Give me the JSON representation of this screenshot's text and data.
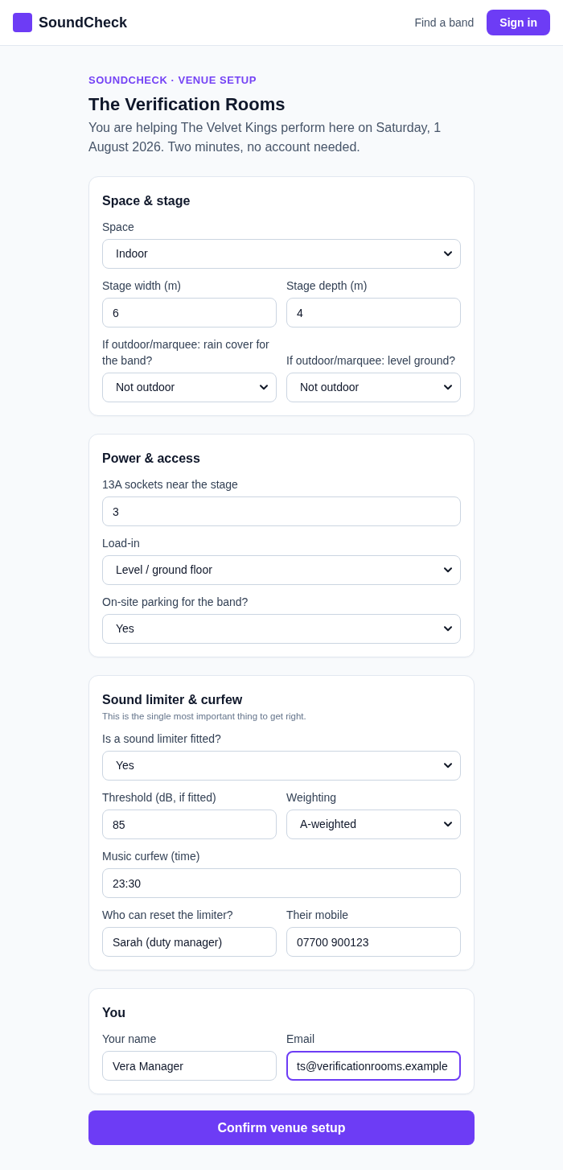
{
  "header": {
    "brand": "SoundCheck",
    "nav_link": "Find a band",
    "sign_in_button": "Sign in"
  },
  "intro": {
    "eyebrow": "SOUNDCHECK · VENUE SETUP",
    "title": "The Verification Rooms",
    "description": "You are helping The Velvet Kings perform here on Saturday, 1 August 2026. Two minutes, no account needed."
  },
  "sections": [
    {
      "title": "Space & stage",
      "rows": [
        {
          "fields": [
            {
              "kind": "select",
              "label": "Space",
              "value": "Indoor",
              "focused": false
            }
          ]
        },
        {
          "fields": [
            {
              "kind": "text",
              "label": "Stage width (m)",
              "value": "6",
              "focused": false
            },
            {
              "kind": "text",
              "label": "Stage depth (m)",
              "value": "4",
              "focused": false
            }
          ]
        },
        {
          "fields": [
            {
              "kind": "select",
              "label": "If outdoor/marquee: rain cover for the band?",
              "value": "Not outdoor",
              "focused": false
            },
            {
              "kind": "select",
              "label": "If outdoor/marquee: level ground?",
              "value": "Not outdoor",
              "focused": false
            }
          ]
        }
      ]
    },
    {
      "title": "Power & access",
      "rows": [
        {
          "fields": [
            {
              "kind": "text",
              "label": "13A sockets near the stage",
              "value": "3",
              "focused": false
            }
          ]
        },
        {
          "fields": [
            {
              "kind": "select",
              "label": "Load-in",
              "value": "Level / ground floor",
              "focused": false
            }
          ]
        },
        {
          "fields": [
            {
              "kind": "select",
              "label": "On-site parking for the band?",
              "value": "Yes",
              "focused": false
            }
          ]
        }
      ]
    },
    {
      "title": "Sound limiter & curfew",
      "note": "This is the single most important thing to get right.",
      "rows": [
        {
          "fields": [
            {
              "kind": "select",
              "label": "Is a sound limiter fitted?",
              "value": "Yes",
              "focused": false
            }
          ]
        },
        {
          "fields": [
            {
              "kind": "text",
              "label": "Threshold (dB, if fitted)",
              "value": "85",
              "focused": false
            },
            {
              "kind": "select",
              "label": "Weighting",
              "value": "A-weighted",
              "focused": false
            }
          ]
        },
        {
          "fields": [
            {
              "kind": "text",
              "label": "Music curfew (time)",
              "value": "23:30",
              "focused": false
            }
          ]
        },
        {
          "fields": [
            {
              "kind": "text",
              "label": "Who can reset the limiter?",
              "value": "Sarah (duty manager)",
              "focused": false
            },
            {
              "kind": "text",
              "label": "Their mobile",
              "value": "07700 900123",
              "focused": false
            }
          ]
        }
      ]
    },
    {
      "title": "You",
      "rows": [
        {
          "fields": [
            {
              "kind": "text",
              "label": "Your name",
              "value": "Vera Manager",
              "focused": false
            },
            {
              "kind": "text",
              "label": "Email",
              "value": "ts@verificationrooms.example",
              "focused": true
            }
          ]
        }
      ]
    }
  ],
  "submit_button": "Confirm venue setup"
}
